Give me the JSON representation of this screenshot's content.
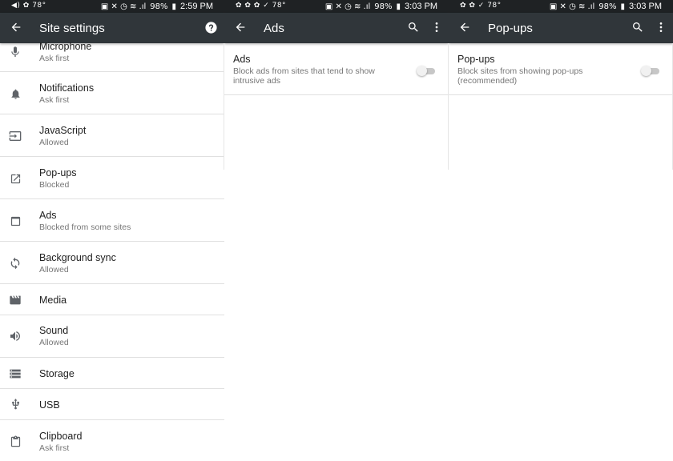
{
  "panels": [
    {
      "status": {
        "left": "◀) ✿ 78°",
        "battery": "98%",
        "time": "2:59 PM"
      },
      "title": "Site settings",
      "items": [
        {
          "title": "Microphone",
          "subtitle": "Ask first",
          "icon": "microphone-icon"
        },
        {
          "title": "Notifications",
          "subtitle": "Ask first",
          "icon": "bell-icon"
        },
        {
          "title": "JavaScript",
          "subtitle": "Allowed",
          "icon": "javascript-icon"
        },
        {
          "title": "Pop-ups",
          "subtitle": "Blocked",
          "icon": "open-in-new-icon"
        },
        {
          "title": "Ads",
          "subtitle": "Blocked from some sites",
          "icon": "window-icon"
        },
        {
          "title": "Background sync",
          "subtitle": "Allowed",
          "icon": "sync-icon"
        },
        {
          "title": "Media",
          "subtitle": "",
          "icon": "film-icon"
        },
        {
          "title": "Sound",
          "subtitle": "Allowed",
          "icon": "speaker-icon"
        },
        {
          "title": "Storage",
          "subtitle": "",
          "icon": "storage-icon"
        },
        {
          "title": "USB",
          "subtitle": "",
          "icon": "usb-icon"
        },
        {
          "title": "Clipboard",
          "subtitle": "Ask first",
          "icon": "clipboard-icon"
        }
      ]
    },
    {
      "status": {
        "left": "✿ ✿ ✿ ✓ 78°",
        "battery": "98%",
        "time": "3:03 PM"
      },
      "title": "Ads",
      "setting": {
        "title": "Ads",
        "description": "Block ads from sites that tend to show intrusive ads",
        "enabled": false
      }
    },
    {
      "status": {
        "left": "✿ ✿ ✓ 78°",
        "battery": "98%",
        "time": "3:03 PM"
      },
      "title": "Pop-ups",
      "setting": {
        "title": "Pop-ups",
        "description": "Block sites from showing pop-ups (recommended)",
        "enabled": false
      }
    }
  ],
  "colors": {
    "appbar": "#30363a",
    "statusbar": "#1f2224",
    "icon": "#5f6368",
    "divider": "#e0e0e0"
  }
}
